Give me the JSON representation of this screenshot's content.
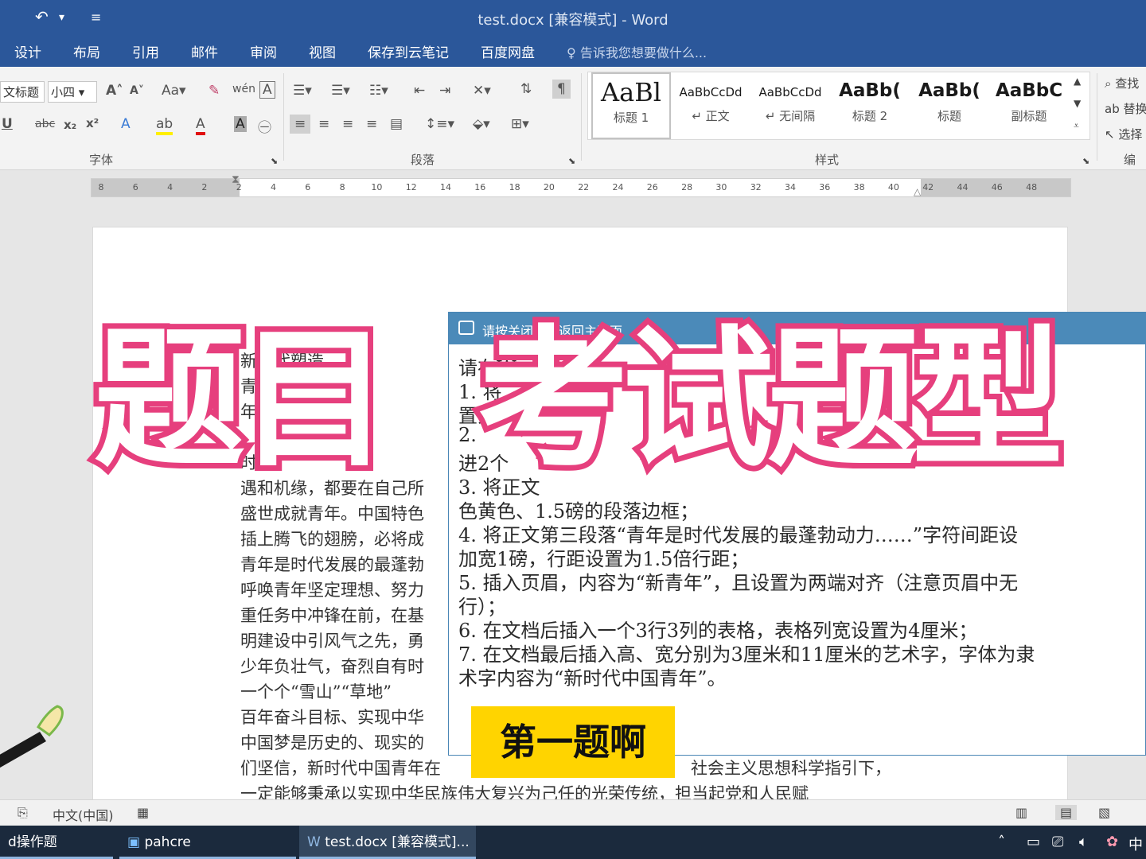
{
  "window": {
    "title": "test.docx [兼容模式] - Word"
  },
  "quick_access": {
    "undo_icon": "undo-icon",
    "more_icon": "customize-icon"
  },
  "tabs": [
    "设计",
    "布局",
    "引用",
    "邮件",
    "审阅",
    "视图",
    "保存到云笔记",
    "百度网盘"
  ],
  "tell_me": {
    "placeholder": "告诉我您想要做什么..."
  },
  "ribbon": {
    "font": {
      "font_name": "文标题",
      "font_size": "小四",
      "group_label": "字体"
    },
    "paragraph": {
      "group_label": "段落"
    },
    "styles": {
      "group_label": "样式",
      "items": [
        {
          "preview": "AaBl",
          "name": "标题 1"
        },
        {
          "preview": "AaBbCcDd",
          "name": "↵ 正文"
        },
        {
          "preview": "AaBbCcDd",
          "name": "↵ 无间隔"
        },
        {
          "preview": "AaBb(",
          "name": "标题 2"
        },
        {
          "preview": "AaBb(",
          "name": "标题"
        },
        {
          "preview": "AaBbC",
          "name": "副标题"
        }
      ]
    },
    "editing": {
      "find": "查找",
      "replace": "替换",
      "select": "选择",
      "group_label": "编辑"
    }
  },
  "ruler": {
    "ticks": [
      "8",
      "6",
      "4",
      "2",
      "2",
      "4",
      "6",
      "8",
      "10",
      "12",
      "14",
      "16",
      "18",
      "20",
      "22",
      "24",
      "26",
      "28",
      "30",
      "32",
      "34",
      "36",
      "38",
      "40",
      "42",
      "44",
      "46",
      "48"
    ]
  },
  "document": {
    "lines": [
      "新时代塑造",
      "青年",
      "年",
      "时",
      "遇和机缘，都要在自己所",
      "盛世成就青年。中国特色",
      "插上腾飞的翅膀，必将成",
      "青年是时代发展的最蓬勃",
      "呼唤青年坚定理想、努力",
      "重任务中冲锋在前，在基",
      "明建设中引风气之先，勇",
      "少年负壮气，奋烈自有时",
      "一个个“雪山”“草地”",
      "百年奋斗目标、实现中华",
      "中国梦是历史的、现实的",
      "们坚信，新时代中国青年在",
      "一定能够秉承以实现中华民族伟大复兴为己任的光荣传统，担当起党和人民赋"
    ],
    "partial_right": "社会主义思想科学指引下，"
  },
  "dialog": {
    "title": "请按关闭按钮返回主页面",
    "lines": [
      "请在W",
      "1. 将",
      "置为",
      "2.",
      "进2个",
      "3. 将正文",
      "色黄色、1.5磅的段落边框；",
      "4. 将正文第三段落“青年是时代发展的最蓬勃动力……”字符间距设",
      "加宽1磅，行距设置为1.5倍行距；",
      "5. 插入页眉，内容为“新青年”，且设置为两端对齐（注意页眉中无",
      "行）；",
      "6. 在文档后插入一个3行3列的表格，表格列宽设置为4厘米；",
      "7. 在文档最后插入高、宽分别为3厘米和11厘米的艺术字，字体为隶",
      "术字内容为“新时代中国青年”。"
    ]
  },
  "overlay": {
    "banner_left": "题目",
    "banner_right": "考试题型",
    "caption": "第一题啊"
  },
  "statusbar": {
    "language": "中文(中国)"
  },
  "taskbar": {
    "items": [
      "d操作题",
      "pahcre",
      "test.docx [兼容模式]..."
    ],
    "ime": "中"
  }
}
